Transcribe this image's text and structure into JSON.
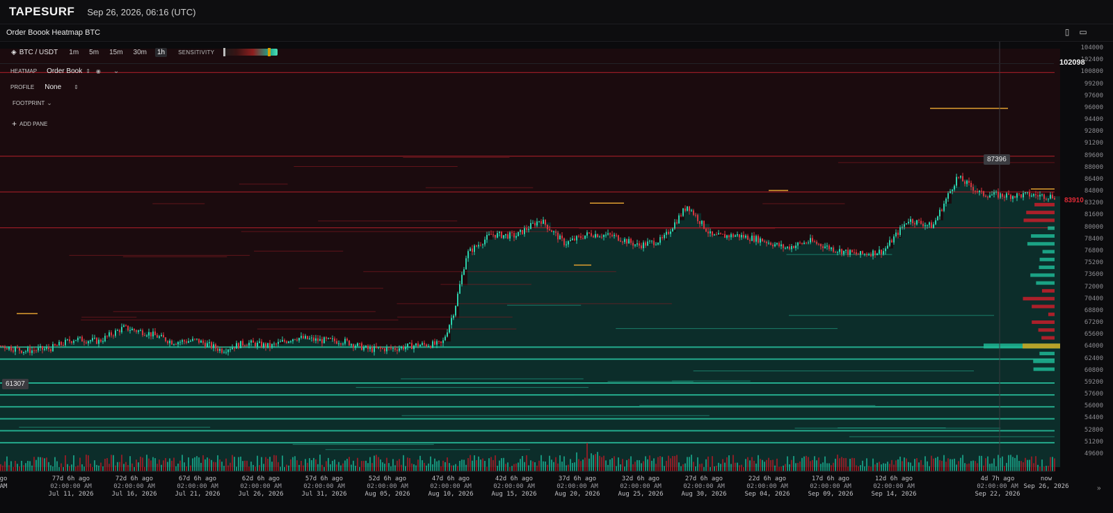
{
  "header": {
    "logo": "TAPESURF",
    "timestamp": "Sep 26, 2026, 06:16 (UTC)"
  },
  "pane": {
    "title": "Order Boook Heatmap BTC"
  },
  "toolbar": {
    "pair": "BTC / USDT",
    "timeframes": [
      "1m",
      "5m",
      "15m",
      "30m",
      "1h"
    ],
    "active_timeframe": "1h",
    "sensitivity_label": "SENSITIVITY"
  },
  "layers": {
    "heatmap_label": "HEATMAP",
    "heatmap_value": "Order Book",
    "profile_label": "PROFILE",
    "profile_value": "None",
    "footprint_label": "FOOTPRINT",
    "add_pane_label": "ADD PANE"
  },
  "price_tags": {
    "high": "87396",
    "low": "61307",
    "last": "83910",
    "cursor": "102098"
  },
  "colors": {
    "background": "#0b0b0d",
    "bid": "#20c9a6",
    "ask": "#c81e2a",
    "accent": "#e0a030"
  },
  "chart_data": {
    "type": "heatmap",
    "title": "Order Boook Heatmap BTC",
    "y_ticks": [
      104000,
      102400,
      100800,
      99200,
      97600,
      96000,
      94400,
      92800,
      91200,
      89600,
      88000,
      86400,
      84800,
      83200,
      81600,
      80000,
      78400,
      76800,
      75200,
      73600,
      72000,
      70400,
      68800,
      67200,
      65600,
      64000,
      62400,
      60800,
      59200,
      57600,
      56000,
      54400,
      52800,
      51200,
      49600
    ],
    "y_range": [
      48600,
      105000
    ],
    "x_labels": [
      {
        "top": "go",
        "bottom": "AM"
      },
      {
        "top": "77d 6h ago",
        "bottom": "Jul 11, 2026"
      },
      {
        "top": "72d 6h ago",
        "bottom": "Jul 16, 2026"
      },
      {
        "top": "67d 6h ago",
        "bottom": "Jul 21, 2026"
      },
      {
        "top": "62d 6h ago",
        "bottom": "Jul 26, 2026"
      },
      {
        "top": "57d 6h ago",
        "bottom": "Jul 31, 2026"
      },
      {
        "top": "52d 6h ago",
        "bottom": "Aug 05, 2026"
      },
      {
        "top": "47d 6h ago",
        "bottom": "Aug 10, 2026"
      },
      {
        "top": "42d 6h ago",
        "bottom": "Aug 15, 2026"
      },
      {
        "top": "37d 6h ago",
        "bottom": "Aug 20, 2026"
      },
      {
        "top": "32d 6h ago",
        "bottom": "Aug 25, 2026"
      },
      {
        "top": "27d 6h ago",
        "bottom": "Aug 30, 2026"
      },
      {
        "top": "22d 6h ago",
        "bottom": "Sep 04, 2026"
      },
      {
        "top": "17d 6h ago",
        "bottom": "Sep 09, 2026"
      },
      {
        "top": "12d 6h ago",
        "bottom": "Sep 14, 2026"
      },
      {
        "top": "4d 7h ago",
        "bottom": "Sep 22, 2026"
      },
      {
        "top": "now",
        "bottom": "Sep 26, 2026"
      }
    ],
    "x_time_sub": "02:00:00 AM",
    "price_path_days": [
      0,
      2,
      4,
      6,
      8,
      10,
      12,
      14,
      16,
      18,
      20,
      22,
      24,
      26,
      28,
      30,
      32,
      34,
      36,
      37,
      38,
      40,
      42,
      44,
      46,
      48,
      50,
      52,
      54,
      56,
      58,
      60,
      62,
      64,
      66,
      68,
      70,
      72,
      74,
      76,
      78,
      80,
      82,
      84,
      86
    ],
    "price_path_values": [
      64200,
      63500,
      63800,
      65100,
      64800,
      66600,
      65900,
      64700,
      64900,
      63600,
      64600,
      64100,
      65300,
      64900,
      64800,
      63700,
      63800,
      64300,
      64400,
      69000,
      76500,
      79100,
      78900,
      81100,
      77900,
      79200,
      78900,
      77600,
      78400,
      83000,
      78800,
      79000,
      78400,
      77300,
      78200,
      77100,
      76400,
      76900,
      81100,
      80200,
      86800,
      84500,
      84300,
      84400,
      84200
    ],
    "volume_label": "volume",
    "bid_walls": [
      64000,
      62400,
      59200,
      57600,
      56000,
      54400,
      52800,
      51200
    ],
    "ask_walls": [
      100800,
      89600,
      84800,
      80000
    ]
  }
}
